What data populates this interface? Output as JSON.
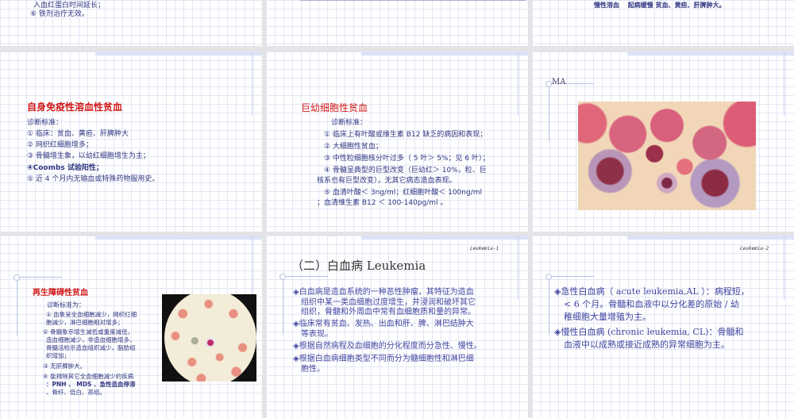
{
  "slides": [
    {
      "lines": [
        "入血红蛋白时间延长；",
        "⑥ 铁剂治疗无效。"
      ]
    },
    {
      "table_note": ""
    },
    {
      "row": "慢性溶血　 起病缓慢 贫血、黄疸、肝脾肿大。"
    },
    {
      "title": "自身免疫性溶血性贫血",
      "lines": [
        "诊断标准：",
        "① 临床：贫血、黄疸、肝脾肿大",
        "② 网织红细胞增多；",
        "③ 骨髓增生象，以幼红细胞增生为主；",
        "④Coombs 试验阳性；",
        "⑤ 近 4 个月内无输血或特殊药物服用史。"
      ]
    },
    {
      "title": "巨幼细胞性贫血",
      "lines": [
        "诊断标准：",
        "① 临床上有叶酸或维生素 B12 缺乏的病因和表现；",
        "② 大细胞性贫血；",
        "③ 中性粒细胞核分叶过多（ 5 叶＞ 5%；见 6 叶）；",
        "④ 骨髓呈典型的巨型改变（巨幼红＞ 10%，粒、巨",
        "核系也有巨型改变），无其它病态造血表现。",
        "⑤ 血清叶酸＜ 3ng/ml；红细胞叶酸＜ 100ng/ml",
        "；血清维生素 B12 ＜ 100-140pg/ml 。"
      ]
    },
    {
      "title": "MA"
    },
    {
      "title": "再生障碍性贫血",
      "lines": [
        "诊断标准为：",
        "① 血象呈全血细胞减少，网织红细",
        "胞减少，淋巴细胞相对增多；",
        "② 骨髓象示增生减低或重度减低，",
        "造血细胞减少，非造血细胞增多，",
        "骨髓活检示造血组织减少，脂肪组",
        "织增加；",
        "③ 无肝脾肿大。",
        "④ 能排除其它全血细胞减少的疾病",
        "：PNH 、 MDS 、急性造血停滞",
        "、骨纤、低白、恶组。"
      ]
    },
    {
      "footer": "Leukemia-1",
      "title": "（二）白血病 Leukemia",
      "lines": [
        "白血病是造血系统的一种恶性肿瘤，其特征为造血",
        "组织中某一类血细胞过度增生，并浸润和破坏其它",
        "组织，骨髓和外周血中常有血细胞质和量的异常。",
        "临床常有贫血、发热、出血和肝、脾、淋巴结肿大",
        "等表现。",
        "根据自然病程及血细胞的分化程度而分急性、慢性。",
        "根据白血病细胞类型不同而分为髓细胞性和淋巴细",
        "胞性。"
      ]
    },
    {
      "footer": "Leukemia-2",
      "lines": [
        "急性白血病（ acute leukemia,AL ）：病程短，",
        "< 6 个月。骨髓和血液中以分化差的原始 / 幼",
        "稚细胞大量增殖为主。",
        "慢性白血病 (chronic leukemia, CL)：骨髓和",
        "血液中以成熟或接近成熟的异常细胞为主。"
      ]
    }
  ],
  "bullet": "◈",
  "colors": {
    "title_red": "#d01818",
    "text_blue": "#2e3580",
    "gap": "#e4e4e6"
  }
}
